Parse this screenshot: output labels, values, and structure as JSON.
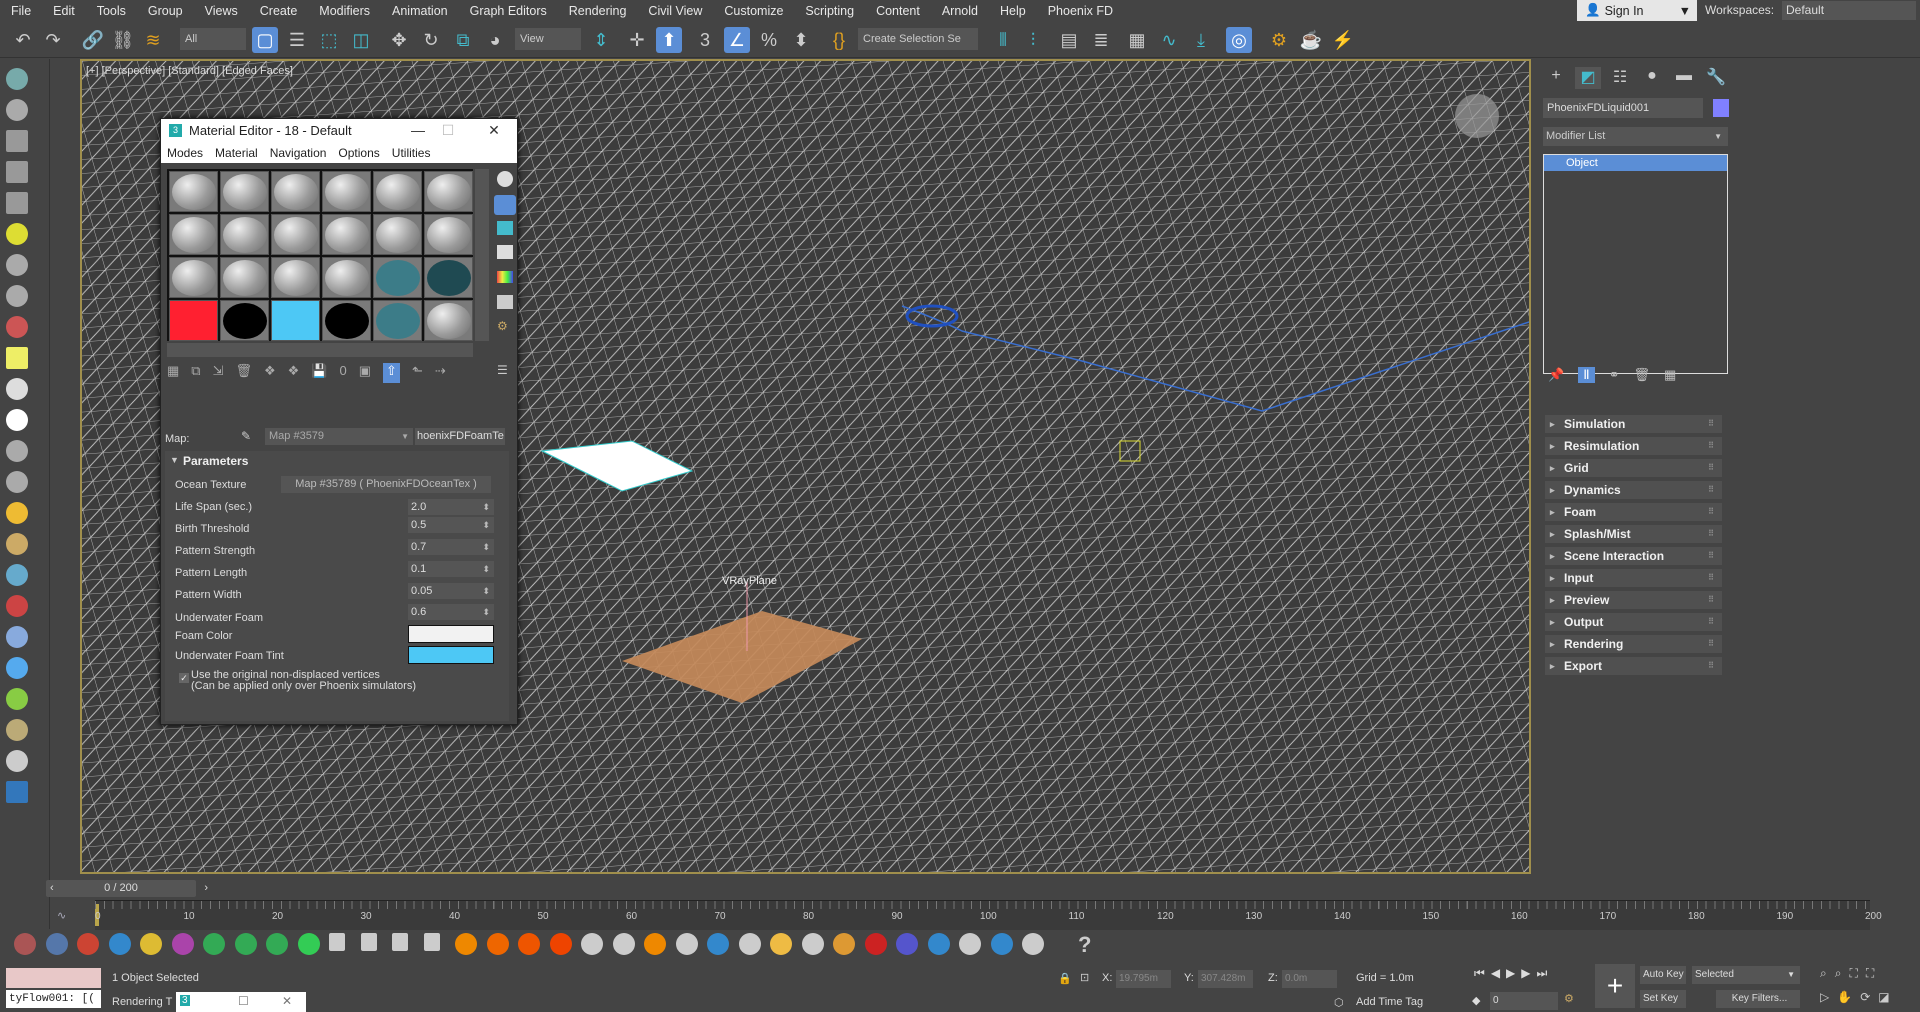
{
  "menu": [
    "File",
    "Edit",
    "Tools",
    "Group",
    "Views",
    "Create",
    "Modifiers",
    "Animation",
    "Graph Editors",
    "Rendering",
    "Civil View",
    "Customize",
    "Scripting",
    "Content",
    "Arnold",
    "Help",
    "Phoenix FD"
  ],
  "signin": {
    "label": "Sign In",
    "icon": "user-icon"
  },
  "workspaces": {
    "label": "Workspaces:",
    "value": "Default"
  },
  "toolbar": {
    "selection_filter": "All",
    "ref_coord": "View",
    "named_selection": "Create Selection Se"
  },
  "viewport": {
    "label": "[+] [Perspective] [Standard] [Edged Faces]",
    "plane_label": "VRayPlane",
    "colors": {
      "bg": "#3c3c3c",
      "wire": "#ffffff",
      "plane": "#c58a5a",
      "border": "#a08f4c"
    }
  },
  "material_editor": {
    "title": "Material Editor - 18 - Default",
    "menu": [
      "Modes",
      "Material",
      "Navigation",
      "Options",
      "Utilities"
    ],
    "slots": [
      "gray",
      "gray",
      "gray",
      "gray",
      "gray",
      "gray",
      "gray",
      "gray",
      "gray",
      "gray",
      "gray",
      "gray",
      "gray",
      "gray",
      "gray",
      "gray",
      "#3c7c88",
      "#1f4a52",
      "#ff2030",
      "#000000",
      "#4dc8f5",
      "#000000",
      "#3c7c88",
      "gray"
    ],
    "map_label": "Map:",
    "map_value": "Map #3579",
    "map_type": "hoenixFDFoamTe",
    "rollout": "Parameters",
    "ocean_texture": {
      "label": "Ocean Texture",
      "value": "Map #35789  ( PhoenixFDOceanTex )"
    },
    "params": [
      {
        "label": "Life Span (sec.)",
        "value": "2.0"
      },
      {
        "label": "Birth Threshold",
        "value": "0.5"
      },
      {
        "label": "Pattern Strength",
        "value": "0.7"
      },
      {
        "label": "Pattern Length",
        "value": "0.1"
      },
      {
        "label": "Pattern Width",
        "value": "0.05"
      },
      {
        "label": "Underwater Foam",
        "value": "0.6"
      }
    ],
    "foam_color": {
      "label": "Foam Color",
      "color": "#f2f2f2"
    },
    "foam_tint": {
      "label": "Underwater Foam Tint",
      "color": "#4dc8f5"
    },
    "checkbox": {
      "line1": "Use the original non-displaced vertices",
      "line2": "(Can be applied only over Phoenix simulators)",
      "checked": true
    }
  },
  "command_panel": {
    "object_name": "PhoenixFDLiquid001",
    "object_color": "#8080ff",
    "modifier_list": "Modifier List",
    "stack": [
      "Object"
    ],
    "rollouts": [
      "Simulation",
      "Resimulation",
      "Grid",
      "Dynamics",
      "Foam",
      "Splash/Mist",
      "Scene Interaction",
      "Input",
      "Preview",
      "Output",
      "Rendering",
      "Export"
    ]
  },
  "timeline": {
    "frame": "0 / 200",
    "ticks": [
      "0",
      "10",
      "20",
      "30",
      "40",
      "50",
      "60",
      "70",
      "80",
      "90",
      "100",
      "110",
      "120",
      "130",
      "140",
      "150",
      "160",
      "170",
      "180",
      "190",
      "200"
    ]
  },
  "status": {
    "selected": "1 Object Selected",
    "rendering": "Rendering T",
    "script_field": "tyFlow001: [(",
    "x_label": "X:",
    "x": "19.795m",
    "y_label": "Y:",
    "y": "307.428m",
    "z_label": "Z:",
    "z": "0.0m",
    "grid": "Grid = 1.0m",
    "add_time_tag": "Add Time Tag",
    "auto_key": "Auto Key",
    "set_key": "Set Key",
    "key_mode": "Selected",
    "key_filters": "Key Filters...",
    "frame_field": "0"
  }
}
